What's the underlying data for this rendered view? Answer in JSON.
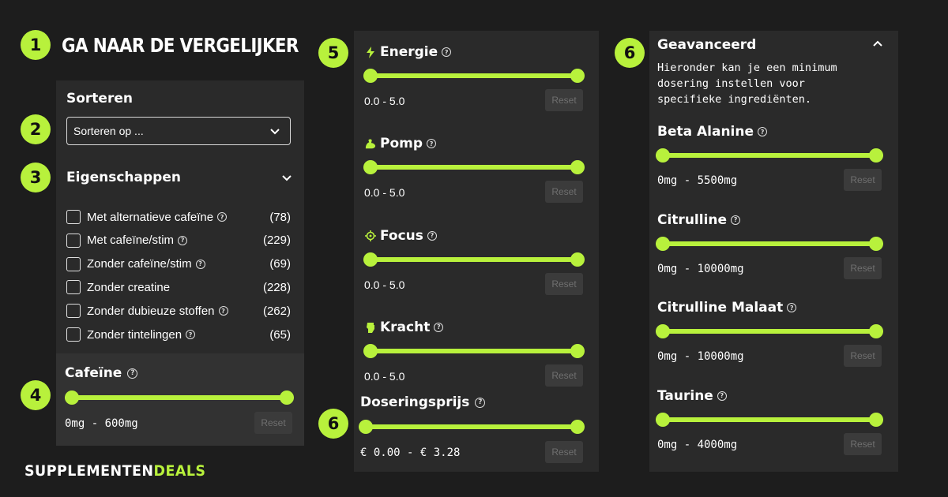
{
  "headline": "GA NAAR DE VERGELIJKER",
  "steps": {
    "s1": "1",
    "s2": "2",
    "s3": "3",
    "s4": "4",
    "s5": "5",
    "s6a": "6",
    "s6b": "6"
  },
  "sort": {
    "title": "Sorteren",
    "select_value": "Sorteren op ..."
  },
  "properties": {
    "title": "Eigenschappen",
    "items": [
      {
        "label": "Met alternatieve cafeïne",
        "count": "(78)",
        "info": true
      },
      {
        "label": "Met cafeïne/stim",
        "count": "(229)",
        "info": true
      },
      {
        "label": "Zonder cafeïne/stim",
        "count": "(69)",
        "info": true
      },
      {
        "label": "Zonder creatine",
        "count": "(228)",
        "info": false
      },
      {
        "label": "Zonder dubieuze stoffen",
        "count": "(262)",
        "info": true
      },
      {
        "label": "Zonder tintelingen",
        "count": "(65)",
        "info": true
      }
    ]
  },
  "caffeine": {
    "title": "Cafeïne",
    "range": "0mg - 600mg",
    "min": 0,
    "max": 600,
    "low": 0,
    "high": 600
  },
  "ratings": [
    {
      "title": "Energie",
      "icon": "bolt-icon",
      "range": "0.0 - 5.0",
      "low": 0.0,
      "high": 5.0
    },
    {
      "title": "Pomp",
      "icon": "flex-arm-icon",
      "range": "0.0 - 5.0",
      "low": 0.0,
      "high": 5.0
    },
    {
      "title": "Focus",
      "icon": "crosshair-icon",
      "range": "0.0 - 5.0",
      "low": 0.0,
      "high": 5.0
    },
    {
      "title": "Kracht",
      "icon": "fist-icon",
      "range": "0.0 - 5.0",
      "low": 0.0,
      "high": 5.0
    }
  ],
  "dose_price": {
    "title": "Doseringsprijs",
    "range": "€ 0.00 - € 3.28",
    "low": 0.0,
    "high": 3.28
  },
  "advanced": {
    "title": "Geavanceerd",
    "description": "Hieronder kan je een minimum dosering instellen voor specifieke ingrediënten.",
    "items": [
      {
        "title": "Beta Alanine",
        "range": "0mg - 5500mg",
        "low": 0,
        "high": 5500
      },
      {
        "title": "Citrulline",
        "range": "0mg - 10000mg",
        "low": 0,
        "high": 10000
      },
      {
        "title": "Citrulline Malaat",
        "range": "0mg - 10000mg",
        "low": 0,
        "high": 10000
      },
      {
        "title": "Taurine",
        "range": "0mg - 4000mg",
        "low": 0,
        "high": 4000
      }
    ]
  },
  "reset_label": "Reset",
  "info_glyph": "?",
  "logo": {
    "part1": "SUPPLEMENTEN",
    "part2": "DEALS"
  },
  "colors": {
    "accent": "#b8f13c",
    "panel": "#2a2a2a",
    "panel_dark": "#323232",
    "background": "#1d1d1d"
  }
}
